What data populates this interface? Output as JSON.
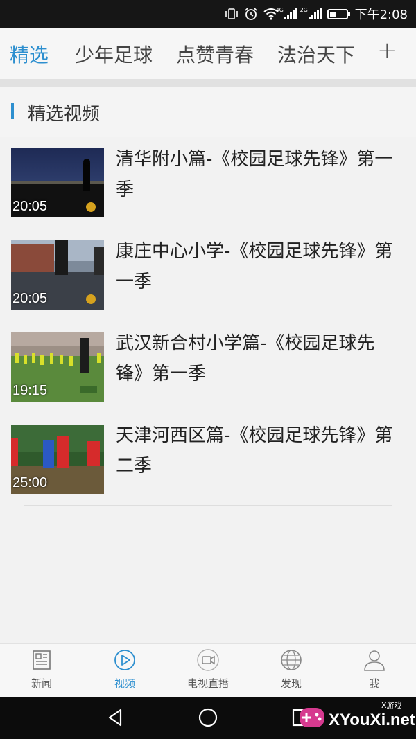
{
  "status_bar": {
    "time": "下午2:08",
    "net1": "4G",
    "net2": "2G",
    "icons": [
      "vibrate-icon",
      "alarm-icon",
      "wifi-icon",
      "signal-icon",
      "signal-icon",
      "battery-icon"
    ]
  },
  "channels": {
    "tabs": [
      "精选",
      "少年足球",
      "点赞青春",
      "法治天下"
    ],
    "active_index": 0,
    "add_label": "+"
  },
  "section": {
    "title": "精选视频"
  },
  "videos": [
    {
      "title": "清华附小篇-《校园足球先锋》第一季",
      "duration": "20:05"
    },
    {
      "title": "康庄中心小学-《校园足球先锋》第一季",
      "duration": "20:05"
    },
    {
      "title": "武汉新合村小学篇-《校园足球先锋》第一季",
      "duration": "19:15"
    },
    {
      "title": "天津河西区篇-《校园足球先锋》第二季",
      "duration": "25:00"
    }
  ],
  "bottom_nav": [
    {
      "label": "新闻",
      "icon": "newspaper-icon"
    },
    {
      "label": "视频",
      "icon": "play-circle-icon",
      "active": true
    },
    {
      "label": "电视直播",
      "icon": "tv-live-icon"
    },
    {
      "label": "发现",
      "icon": "globe-icon"
    },
    {
      "label": "我",
      "icon": "user-icon"
    }
  ],
  "watermark": {
    "text": "XYouXi.net",
    "small": "X游戏"
  },
  "colors": {
    "accent": "#2d8fcf",
    "status_bar": "#161616",
    "system_nav": "#0c0c0c"
  }
}
